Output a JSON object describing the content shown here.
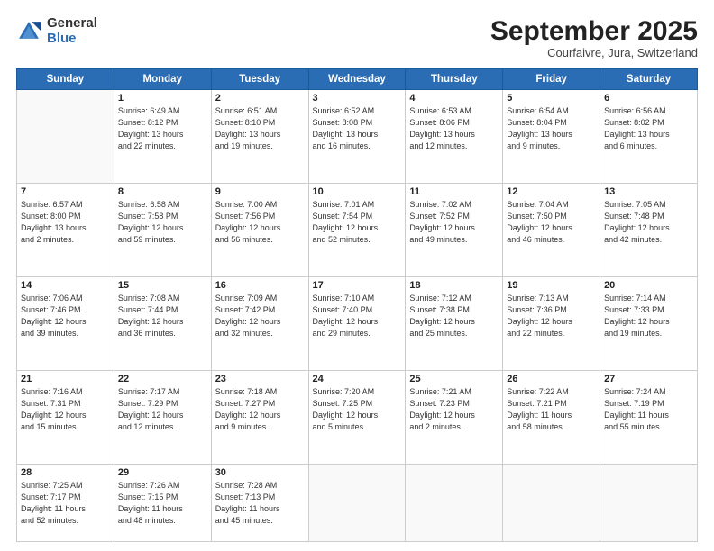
{
  "logo": {
    "general": "General",
    "blue": "Blue"
  },
  "header": {
    "month": "September 2025",
    "location": "Courfaivre, Jura, Switzerland"
  },
  "weekdays": [
    "Sunday",
    "Monday",
    "Tuesday",
    "Wednesday",
    "Thursday",
    "Friday",
    "Saturday"
  ],
  "weeks": [
    [
      {
        "day": null,
        "text": null
      },
      {
        "day": "1",
        "text": "Sunrise: 6:49 AM\nSunset: 8:12 PM\nDaylight: 13 hours\nand 22 minutes."
      },
      {
        "day": "2",
        "text": "Sunrise: 6:51 AM\nSunset: 8:10 PM\nDaylight: 13 hours\nand 19 minutes."
      },
      {
        "day": "3",
        "text": "Sunrise: 6:52 AM\nSunset: 8:08 PM\nDaylight: 13 hours\nand 16 minutes."
      },
      {
        "day": "4",
        "text": "Sunrise: 6:53 AM\nSunset: 8:06 PM\nDaylight: 13 hours\nand 12 minutes."
      },
      {
        "day": "5",
        "text": "Sunrise: 6:54 AM\nSunset: 8:04 PM\nDaylight: 13 hours\nand 9 minutes."
      },
      {
        "day": "6",
        "text": "Sunrise: 6:56 AM\nSunset: 8:02 PM\nDaylight: 13 hours\nand 6 minutes."
      }
    ],
    [
      {
        "day": "7",
        "text": "Sunrise: 6:57 AM\nSunset: 8:00 PM\nDaylight: 13 hours\nand 2 minutes."
      },
      {
        "day": "8",
        "text": "Sunrise: 6:58 AM\nSunset: 7:58 PM\nDaylight: 12 hours\nand 59 minutes."
      },
      {
        "day": "9",
        "text": "Sunrise: 7:00 AM\nSunset: 7:56 PM\nDaylight: 12 hours\nand 56 minutes."
      },
      {
        "day": "10",
        "text": "Sunrise: 7:01 AM\nSunset: 7:54 PM\nDaylight: 12 hours\nand 52 minutes."
      },
      {
        "day": "11",
        "text": "Sunrise: 7:02 AM\nSunset: 7:52 PM\nDaylight: 12 hours\nand 49 minutes."
      },
      {
        "day": "12",
        "text": "Sunrise: 7:04 AM\nSunset: 7:50 PM\nDaylight: 12 hours\nand 46 minutes."
      },
      {
        "day": "13",
        "text": "Sunrise: 7:05 AM\nSunset: 7:48 PM\nDaylight: 12 hours\nand 42 minutes."
      }
    ],
    [
      {
        "day": "14",
        "text": "Sunrise: 7:06 AM\nSunset: 7:46 PM\nDaylight: 12 hours\nand 39 minutes."
      },
      {
        "day": "15",
        "text": "Sunrise: 7:08 AM\nSunset: 7:44 PM\nDaylight: 12 hours\nand 36 minutes."
      },
      {
        "day": "16",
        "text": "Sunrise: 7:09 AM\nSunset: 7:42 PM\nDaylight: 12 hours\nand 32 minutes."
      },
      {
        "day": "17",
        "text": "Sunrise: 7:10 AM\nSunset: 7:40 PM\nDaylight: 12 hours\nand 29 minutes."
      },
      {
        "day": "18",
        "text": "Sunrise: 7:12 AM\nSunset: 7:38 PM\nDaylight: 12 hours\nand 25 minutes."
      },
      {
        "day": "19",
        "text": "Sunrise: 7:13 AM\nSunset: 7:36 PM\nDaylight: 12 hours\nand 22 minutes."
      },
      {
        "day": "20",
        "text": "Sunrise: 7:14 AM\nSunset: 7:33 PM\nDaylight: 12 hours\nand 19 minutes."
      }
    ],
    [
      {
        "day": "21",
        "text": "Sunrise: 7:16 AM\nSunset: 7:31 PM\nDaylight: 12 hours\nand 15 minutes."
      },
      {
        "day": "22",
        "text": "Sunrise: 7:17 AM\nSunset: 7:29 PM\nDaylight: 12 hours\nand 12 minutes."
      },
      {
        "day": "23",
        "text": "Sunrise: 7:18 AM\nSunset: 7:27 PM\nDaylight: 12 hours\nand 9 minutes."
      },
      {
        "day": "24",
        "text": "Sunrise: 7:20 AM\nSunset: 7:25 PM\nDaylight: 12 hours\nand 5 minutes."
      },
      {
        "day": "25",
        "text": "Sunrise: 7:21 AM\nSunset: 7:23 PM\nDaylight: 12 hours\nand 2 minutes."
      },
      {
        "day": "26",
        "text": "Sunrise: 7:22 AM\nSunset: 7:21 PM\nDaylight: 11 hours\nand 58 minutes."
      },
      {
        "day": "27",
        "text": "Sunrise: 7:24 AM\nSunset: 7:19 PM\nDaylight: 11 hours\nand 55 minutes."
      }
    ],
    [
      {
        "day": "28",
        "text": "Sunrise: 7:25 AM\nSunset: 7:17 PM\nDaylight: 11 hours\nand 52 minutes."
      },
      {
        "day": "29",
        "text": "Sunrise: 7:26 AM\nSunset: 7:15 PM\nDaylight: 11 hours\nand 48 minutes."
      },
      {
        "day": "30",
        "text": "Sunrise: 7:28 AM\nSunset: 7:13 PM\nDaylight: 11 hours\nand 45 minutes."
      },
      {
        "day": null,
        "text": null
      },
      {
        "day": null,
        "text": null
      },
      {
        "day": null,
        "text": null
      },
      {
        "day": null,
        "text": null
      }
    ]
  ]
}
